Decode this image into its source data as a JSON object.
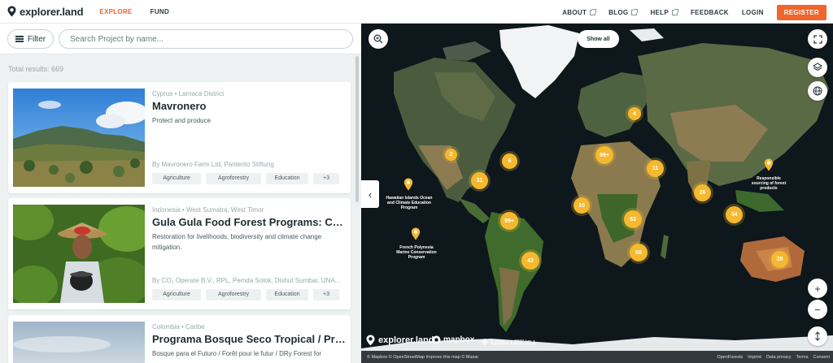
{
  "header": {
    "logo_text": "explorer.land",
    "nav_left": [
      {
        "label": "EXPLORE",
        "active": true
      },
      {
        "label": "FUND",
        "active": false
      }
    ],
    "nav_right": {
      "about": "ABOUT",
      "blog": "BLOG",
      "help": "HELP",
      "feedback": "FEEDBACK",
      "login": "LOGIN",
      "register": "REGISTER"
    },
    "accent_color": "#f0652b"
  },
  "sidebar": {
    "filter_label": "Filter",
    "search_placeholder": "Search Project by name...",
    "total_results": "Total results: 669",
    "cards": [
      {
        "location": "Cyprus • Larnaca District",
        "title": "Mavronero",
        "description": "Protect and produce",
        "org": "By Mavronero Farm Ltd, Panterito Stiftung",
        "tags": [
          "Agriculture",
          "Agroforestry",
          "Education",
          "+3"
        ]
      },
      {
        "location": "Indonesia • West Sumatra, West Timor",
        "title": "Gula Gula Food Forest Programs: Carbon ...",
        "description": "Restoration for livelihoods, biodiversity and climate change mitigation.",
        "org": "By CO₂ Operate B.V., RPL, Pemda Solok, Dishut Sumbar, UNA...",
        "tags": [
          "Agriculture",
          "Agroforestry",
          "Education",
          "+3"
        ]
      },
      {
        "location": "Colombia • Caribe",
        "title": "Programa Bosque Seco Tropical / Progra...",
        "description": "Bosque para el Futuro / Forêt pour le futur / DRy Forest for",
        "org": "",
        "tags": []
      }
    ]
  },
  "map": {
    "show_all": "Show all",
    "clusters": [
      "4",
      "2",
      "6",
      "99+",
      "31",
      "11",
      "26",
      "10",
      "63",
      "99+",
      "34",
      "60",
      "43",
      "28"
    ],
    "pins": [
      {
        "label": "Hawaiian Islands Ocean and Climate Education Program"
      },
      {
        "label": "French Polynesia Marine Conservation Program"
      },
      {
        "label": "Responsible sourcing of forest products"
      }
    ],
    "brand": "explorer.land",
    "mapbox": "mapbox",
    "scale_a": "2000",
    "scale_b": "3000 km",
    "attribution": "© Mapbox © OpenStreetMap Improve this map © Maxar",
    "footer_links": [
      "OpenForests",
      "Imprint",
      "Data privacy",
      "Terms",
      "Consent"
    ]
  }
}
